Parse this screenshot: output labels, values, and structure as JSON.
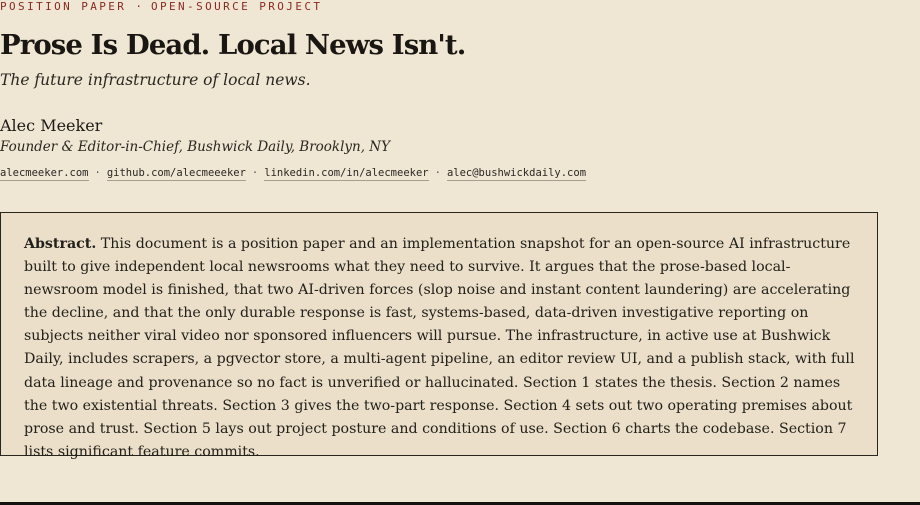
{
  "header": {
    "kicker_left": "POSITION PAPER",
    "kicker_sep": "·",
    "kicker_right": "OPEN-SOURCE PROJECT",
    "title": "Prose Is Dead. Local News Isn't.",
    "subtitle": "The future infrastructure of local news."
  },
  "author": {
    "name": "Alec Meeker",
    "role": "Founder & Editor-in-Chief, Bushwick Daily, Brooklyn, NY",
    "links": [
      "alecmeeker.com",
      "github.com/alecmeeeker",
      "linkedin.com/in/alecmeeker",
      "alec@bushwickdaily.com"
    ],
    "link_sep": "·"
  },
  "abstract": {
    "label": "Abstract.",
    "text": "This document is a position paper and an implementation snapshot for an open-source AI infrastructure built to give independent local newsrooms what they need to survive. It argues that the prose-based local-newsroom model is finished, that two AI-driven forces (slop noise and instant content laundering) are accelerating the decline, and that the only durable response is fast, systems-based, data-driven investigative reporting on subjects neither viral video nor sponsored influencers will pursue. The infrastructure, in active use at Bushwick Daily, includes scrapers, a pgvector store, a multi-agent pipeline, an editor review UI, and a publish stack, with full data lineage and provenance so no fact is unverified or hallucinated. Section 1 states the thesis. Section 2 names the two existential threats. Section 3 gives the two-part response. Section 4 sets out two operating premises about prose and trust. Section 5 lays out project posture and conditions of use. Section 6 charts the codebase. Section 7 lists significant feature commits."
  }
}
